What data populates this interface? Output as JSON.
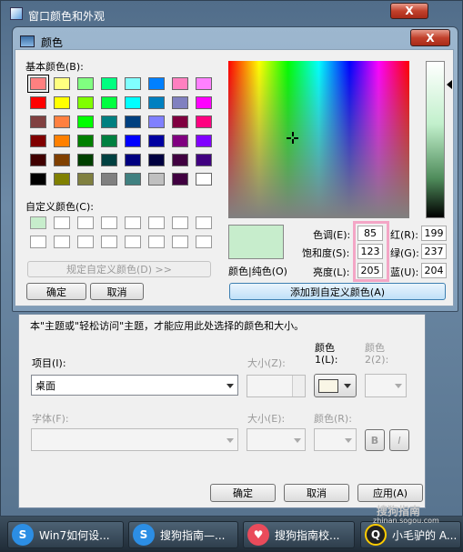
{
  "outer_window": {
    "title": "窗口颜色和外观",
    "close": "X"
  },
  "color_dialog": {
    "title": "颜色",
    "close": "X",
    "basic_colors_label": "基本颜色(B):",
    "custom_colors_label": "自定义颜色(C):",
    "define_button": "规定自定义颜色(D) >>",
    "ok": "确定",
    "cancel": "取消",
    "solid_label": "颜色|纯色(O)",
    "hue_label": "色调(E):",
    "hue": "85",
    "sat_label": "饱和度(S):",
    "sat": "123",
    "lum_label": "亮度(L):",
    "lum": "205",
    "red_label": "红(R):",
    "red": "199",
    "green_label": "绿(G):",
    "green": "237",
    "blue_label": "蓝(U):",
    "blue": "204",
    "add_button": "添加到自定义颜色(A)",
    "preview_color": "#c7edcc",
    "basic_colors": [
      "#ff8080",
      "#ffff80",
      "#80ff80",
      "#00ff80",
      "#80ffff",
      "#0080ff",
      "#ff80c0",
      "#ff80ff",
      "#ff0000",
      "#ffff00",
      "#80ff00",
      "#00ff40",
      "#00ffff",
      "#0080c0",
      "#8080c0",
      "#ff00ff",
      "#804040",
      "#ff8040",
      "#00ff00",
      "#008080",
      "#004080",
      "#8080ff",
      "#800040",
      "#ff0080",
      "#800000",
      "#ff8000",
      "#008000",
      "#008040",
      "#0000ff",
      "#0000a0",
      "#800080",
      "#8000ff",
      "#400000",
      "#804000",
      "#004000",
      "#004040",
      "#000080",
      "#000040",
      "#400040",
      "#400080",
      "#000000",
      "#808000",
      "#808040",
      "#808080",
      "#408080",
      "#c0c0c0",
      "#400040",
      "#ffffff"
    ],
    "custom_colors": [
      "#c7edcc",
      "#ffffff",
      "#ffffff",
      "#ffffff",
      "#ffffff",
      "#ffffff",
      "#ffffff",
      "#ffffff",
      "#ffffff",
      "#ffffff",
      "#ffffff",
      "#ffffff",
      "#ffffff",
      "#ffffff",
      "#ffffff",
      "#ffffff"
    ]
  },
  "appearance": {
    "notice": "本\"主题或\"轻松访问\"主题，才能应用此处选择的颜色和大小。",
    "item_label": "项目(I):",
    "item_value": "桌面",
    "size_label": "大小(Z):",
    "color1_label_a": "颜色",
    "color1_label_b": "1(L):",
    "color2_label_a": "颜色",
    "color2_label_b": "2(2):",
    "font_label": "字体(F):",
    "size2_label": "大小(E):",
    "color3_label": "颜色(R):",
    "bold": "B",
    "italic": "I",
    "ok": "确定",
    "cancel": "取消",
    "apply": "应用(A)"
  },
  "taskbar": [
    {
      "label": "Win7如何设...",
      "icon": "S"
    },
    {
      "label": "搜狗指南—...",
      "icon": "S"
    },
    {
      "label": "搜狗指南校...",
      "icon": "♥"
    },
    {
      "label": "小毛驴的 A...",
      "icon": "Q"
    }
  ],
  "watermark": "搜狗指南",
  "watermark_url": "zhinan.sogou.com"
}
